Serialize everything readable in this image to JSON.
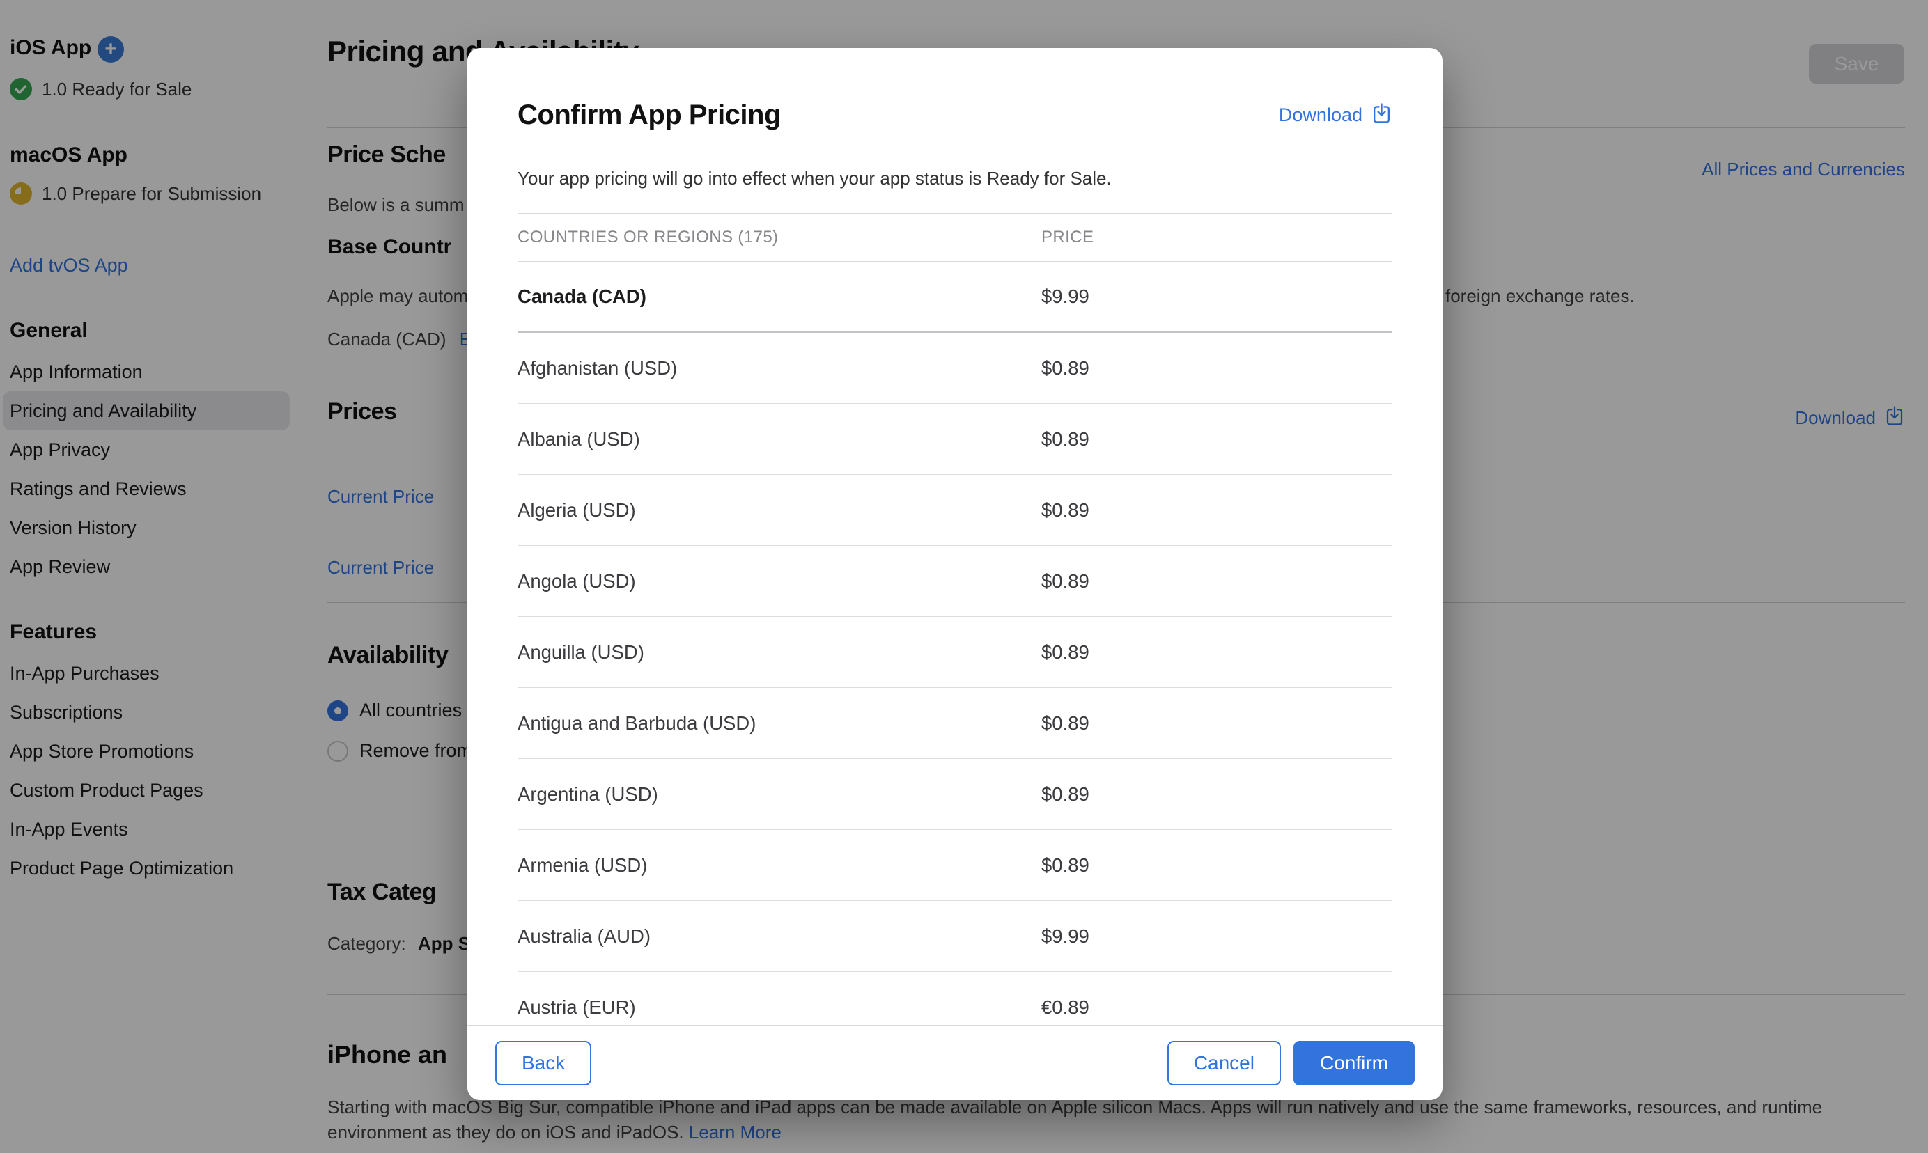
{
  "accent": "#3273de",
  "sidebar": {
    "ios": {
      "title": "iOS App",
      "status": "1.0 Ready for Sale"
    },
    "macos": {
      "title": "macOS App",
      "status": "1.0 Prepare for Submission"
    },
    "add_tvos_link": "Add tvOS App",
    "general": {
      "title": "General",
      "active": "Pricing and Availability",
      "items": [
        "App Information",
        "Pricing and Availability",
        "App Privacy",
        "Ratings and Reviews",
        "Version History",
        "App Review"
      ]
    },
    "features": {
      "title": "Features",
      "items": [
        "In-App Purchases",
        "Subscriptions",
        "App Store Promotions",
        "Custom Product Pages",
        "In-App Events",
        "Product Page Optimization"
      ]
    }
  },
  "page": {
    "title": "Pricing and Availability",
    "save_label": "Save",
    "price_schedule_heading": "Price Sche",
    "all_prices_link": "All Prices and Currencies",
    "below_text": "Below is a summ",
    "base_country_heading": "Base Countr",
    "apple_may_text": "Apple may autom",
    "foreign_text": "foreign exchange rates.",
    "canada_label": "Canada (CAD)",
    "canada_edit_link": "Ed",
    "prices_heading": "Prices",
    "download_link": "Download",
    "current_price_link_1": "Current Price",
    "current_price_link_2": "Current Price",
    "availability_heading": "Availability",
    "radio_all_label": "All countries o",
    "radio_remove_label": "Remove from",
    "tax_heading": "Tax Categ",
    "category_label": "Category:",
    "category_value": "App S",
    "iphone_heading": "iPhone an",
    "footnote_line1": "Starting with macOS Big Sur, compatible iPhone and iPad apps can be made available on Apple silicon Macs. Apps will run natively and use the same frameworks, resources, and runtime",
    "footnote_line2": "environment as they do on iOS and iPadOS.",
    "learn_more_link": "Learn More"
  },
  "modal": {
    "title": "Confirm App Pricing",
    "download_label": "Download",
    "description": "Your app pricing will go into effect when your app status is Ready for Sale.",
    "table": {
      "col_country": "COUNTRIES OR REGIONS (175)",
      "col_price": "PRICE",
      "rows": [
        {
          "country": "Canada (CAD)",
          "price": "$9.99",
          "base": true
        },
        {
          "country": "Afghanistan (USD)",
          "price": "$0.89"
        },
        {
          "country": "Albania (USD)",
          "price": "$0.89"
        },
        {
          "country": "Algeria (USD)",
          "price": "$0.89"
        },
        {
          "country": "Angola (USD)",
          "price": "$0.89"
        },
        {
          "country": "Anguilla (USD)",
          "price": "$0.89"
        },
        {
          "country": "Antigua and Barbuda (USD)",
          "price": "$0.89"
        },
        {
          "country": "Argentina (USD)",
          "price": "$0.89"
        },
        {
          "country": "Armenia (USD)",
          "price": "$0.89"
        },
        {
          "country": "Australia (AUD)",
          "price": "$9.99"
        },
        {
          "country": "Austria (EUR)",
          "price": "€0.89"
        }
      ]
    },
    "buttons": {
      "back": "Back",
      "cancel": "Cancel",
      "confirm": "Confirm"
    }
  }
}
